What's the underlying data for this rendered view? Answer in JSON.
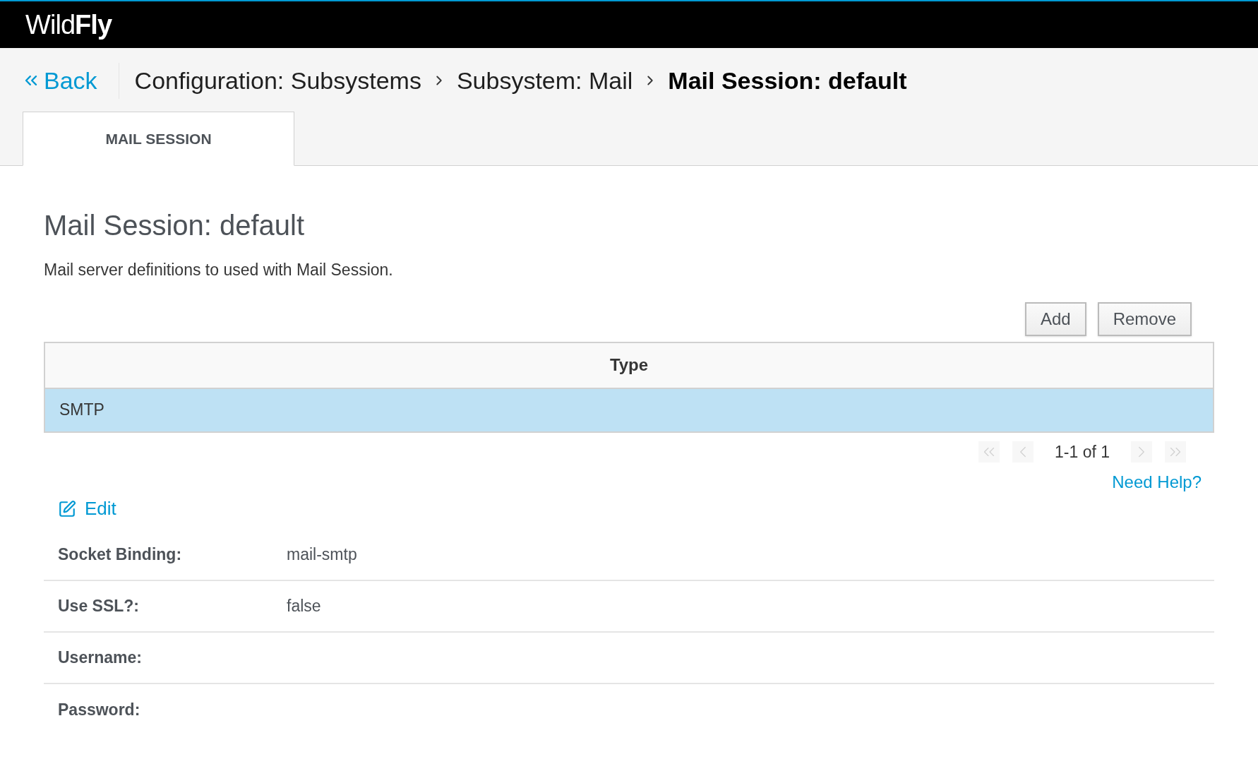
{
  "header": {
    "logo": "Wild**Fly**"
  },
  "breadcrumb": {
    "back": "Back",
    "items": [
      {
        "label": "Configuration: Subsystems",
        "current": false
      },
      {
        "label": "Subsystem: Mail",
        "current": false
      },
      {
        "label": "Mail Session: default",
        "current": true
      }
    ]
  },
  "tabs": [
    {
      "label": "MAIL SESSION",
      "selected": true
    }
  ],
  "page": {
    "title": "Mail Session: default",
    "description": "Mail server definitions to used with Mail Session."
  },
  "toolbar": {
    "buttons": [
      "Add",
      "Remove"
    ]
  },
  "table": {
    "columns": [
      "Type"
    ],
    "rows": [
      {
        "cells": [
          "SMTP"
        ],
        "selected": true
      }
    ]
  },
  "pager": {
    "range": "1-1 of 1",
    "first_disabled": true,
    "prev_disabled": true,
    "next_disabled": true,
    "last_disabled": true
  },
  "help_link": "Need Help?",
  "form": {
    "edit": "Edit",
    "fields": [
      {
        "label": "Socket Binding:",
        "value": "mail-smtp"
      },
      {
        "label": "Use SSL?:",
        "value": "false"
      },
      {
        "label": "Username:"
      },
      {
        "label": "Password:"
      }
    ]
  }
}
